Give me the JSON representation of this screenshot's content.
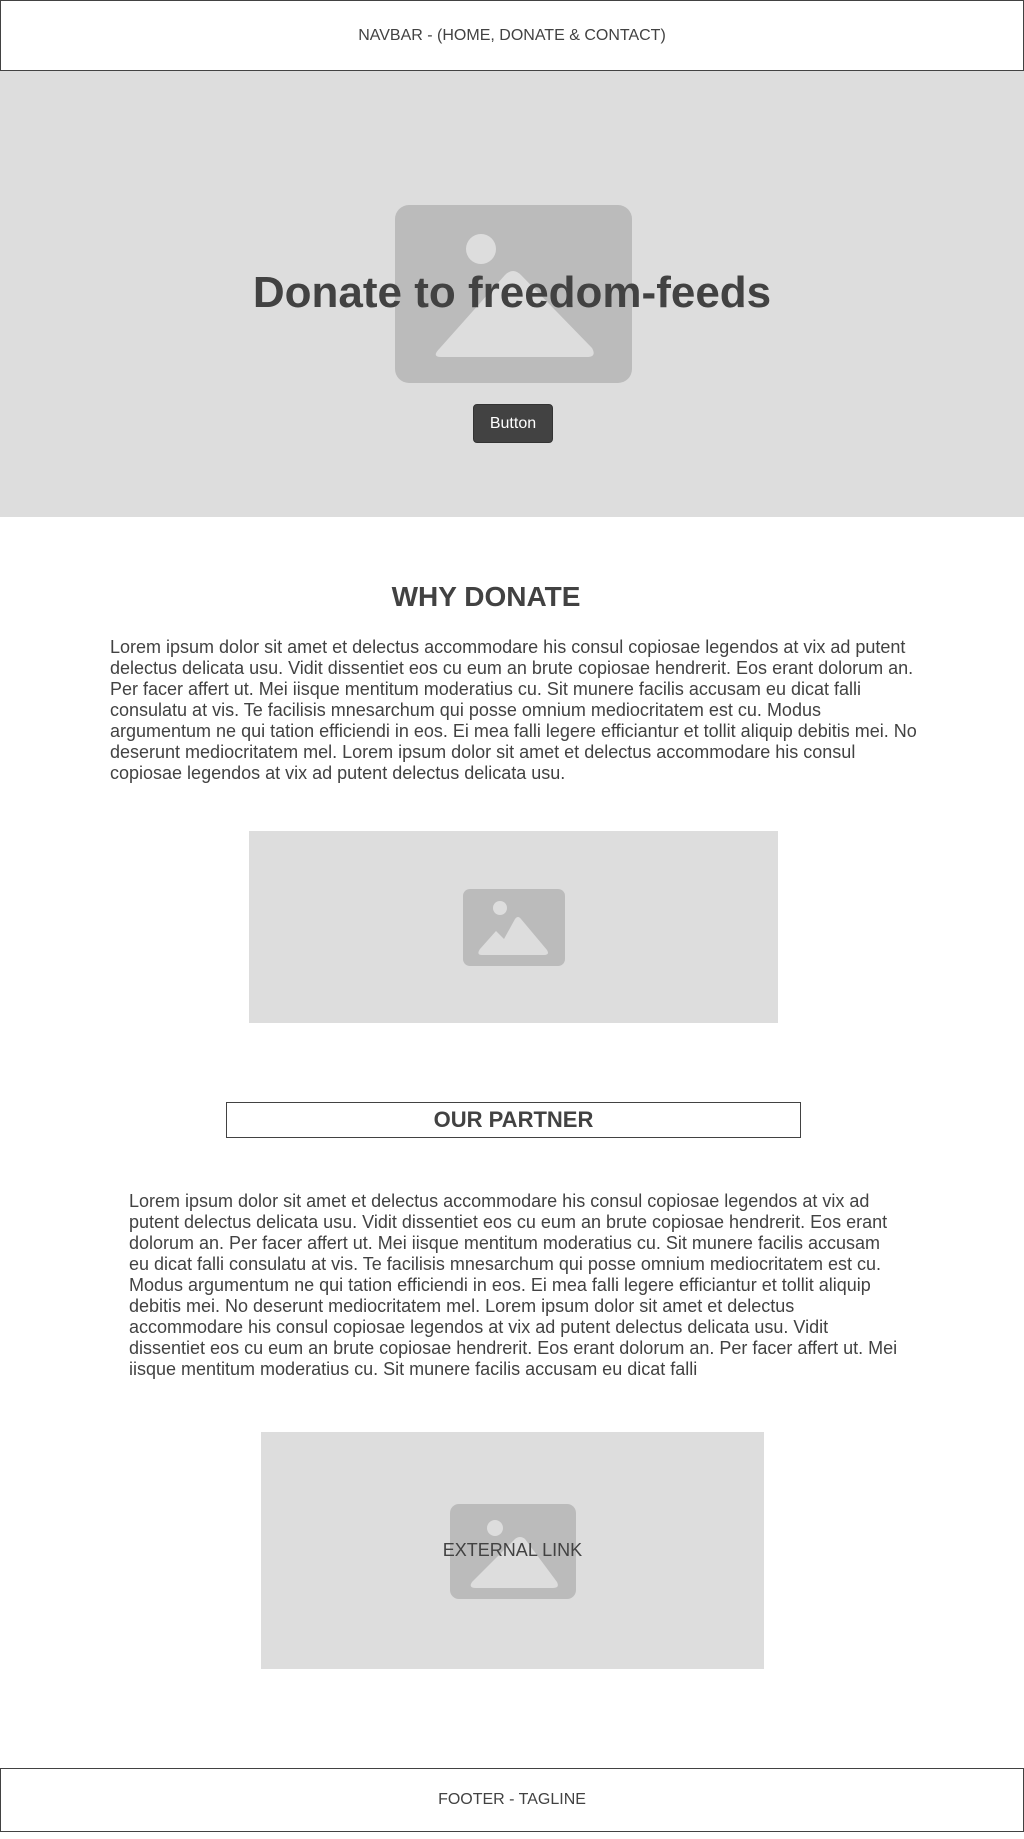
{
  "navbar": {
    "label": "NAVBAR - (HOME, DONATE & CONTACT)"
  },
  "hero": {
    "title": "Donate to freedom-feeds",
    "button_label": "Button",
    "image_icon": "image-placeholder-icon"
  },
  "why_donate": {
    "title": "WHY DONATE",
    "text": "Lorem ipsum dolor sit amet et delectus accommodare his consul copiosae legendos at vix ad putent delectus delicata usu. Vidit dissentiet eos cu eum an brute copiosae hendrerit. Eos erant dolorum an. Per facer affert ut. Mei iisque mentitum moderatius cu. Sit munere facilis accusam eu dicat falli consulatu at vis. Te facilisis mnesarchum qui posse omnium mediocritatem est cu. Modus argumentum ne qui tation efficiendi in eos. Ei mea falli legere efficiantur et tollit aliquip debitis mei. No deserunt mediocritatem mel. Lorem ipsum dolor sit amet et delectus accommodare his consul copiosae legendos at vix ad putent delectus delicata usu."
  },
  "our_partner": {
    "title": "OUR PARTNER",
    "text": "Lorem ipsum dolor sit amet et delectus accommodare his consul copiosae legendos at vix ad putent delectus delicata usu. Vidit dissentiet eos cu eum an brute copiosae hendrerit. Eos erant dolorum an. Per facer affert ut. Mei iisque mentitum moderatius cu. Sit munere facilis accusam eu dicat falli consulatu at vis. Te facilisis mnesarchum qui posse omnium mediocritatem est cu. Modus argumentum ne qui tation efficiendi in eos. Ei mea falli legere efficiantur et tollit aliquip debitis mei. No deserunt mediocritatem mel. Lorem ipsum dolor sit amet et delectus accommodare his consul copiosae legendos at vix ad putent delectus delicata usu. Vidit dissentiet eos cu eum an brute copiosae hendrerit. Eos erant dolorum an. Per facer affert ut. Mei iisque mentitum moderatius cu. Sit munere facilis accusam eu dicat falli",
    "external_link": "EXTERNAL LINK"
  },
  "footer": {
    "label": "FOOTER - TAGLINE"
  },
  "colors": {
    "text": "#424242",
    "placeholder_bg": "#dddddd",
    "placeholder_icon": "#bbbbbb",
    "button_bg": "#424242",
    "button_text": "#ffffff"
  }
}
